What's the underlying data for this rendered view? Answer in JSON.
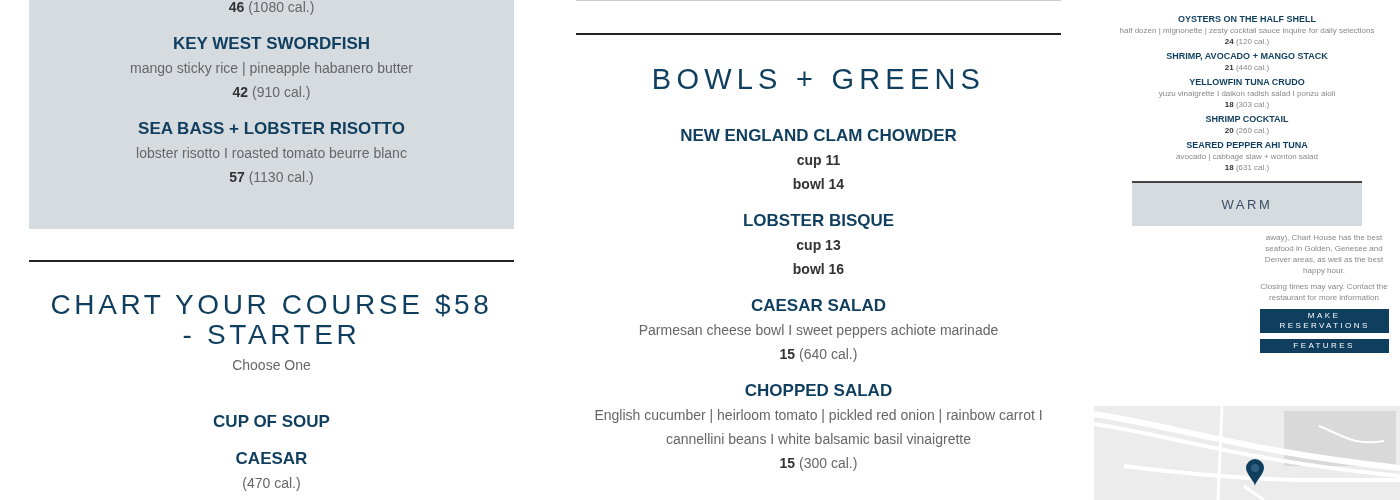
{
  "left": {
    "panel_items": [
      {
        "price": "46",
        "calories": "(1080 cal.)"
      },
      {
        "name": "KEY WEST SWORDFISH",
        "description": "mango sticky rice | pineapple habanero butter",
        "price": "42",
        "calories": "(910 cal.)"
      },
      {
        "name": "SEA BASS + LOBSTER RISOTTO",
        "description": "lobster risotto I roasted tomato beurre blanc",
        "price": "57",
        "calories": "(1130 cal.)"
      }
    ],
    "section": {
      "title": "CHART YOUR COURSE $58 - STARTER",
      "subtitle": "Choose One",
      "items": [
        {
          "name": "CUP OF SOUP"
        },
        {
          "name": "CAESAR",
          "calories": "(470 cal.)"
        }
      ]
    }
  },
  "middle": {
    "title": "BOWLS + GREENS",
    "items": [
      {
        "name": "NEW ENGLAND CLAM CHOWDER",
        "sizes": [
          "cup 11",
          "bowl 14"
        ]
      },
      {
        "name": "LOBSTER BISQUE",
        "sizes": [
          "cup 13",
          "bowl 16"
        ]
      },
      {
        "name": "CAESAR SALAD",
        "description": "Parmesan cheese bowl I sweet peppers achiote marinade",
        "price": "15",
        "calories": "(640 cal.)"
      },
      {
        "name": "CHOPPED SALAD",
        "description": "English cucumber | heirloom tomato | pickled red onion | rainbow carrot I cannellini beans I white balsamic basil vinaigrette",
        "price": "15",
        "calories": "(300 cal.)"
      }
    ]
  },
  "right": {
    "items": [
      {
        "name": "OYSTERS ON THE HALF SHELL",
        "description": "half dozen | mignonette | zesty cocktail sauce inquire for daily selections",
        "price": "24",
        "calories": "(120 cal.)"
      },
      {
        "name": "SHRIMP, AVOCADO + MANGO STACK",
        "price": "21",
        "calories": "(440 cal.)"
      },
      {
        "name": "YELLOWFIN TUNA CRUDO",
        "description": "yuzu vinaigrette I daikon radish salad I ponzu aioli",
        "price": "18",
        "calories": "(303 cal.)"
      },
      {
        "name": "SHRIMP COCKTAIL",
        "price": "20",
        "calories": "(260 cal.)"
      },
      {
        "name": "SEARED PEPPER AHI TUNA",
        "description": "avocado | cabbage slaw + wonton salad",
        "price": "18",
        "calories": "(631 cal.)"
      }
    ],
    "heading": "WARM",
    "info": [
      "away), Chart House has the best seafood in Golden, Genesee and Denver areas, as well as the best happy hour.",
      "Closing times may vary. Contact the restaurant for more information"
    ],
    "buttons": [
      "MAKE RESERVATIONS",
      "FEATURES"
    ]
  }
}
